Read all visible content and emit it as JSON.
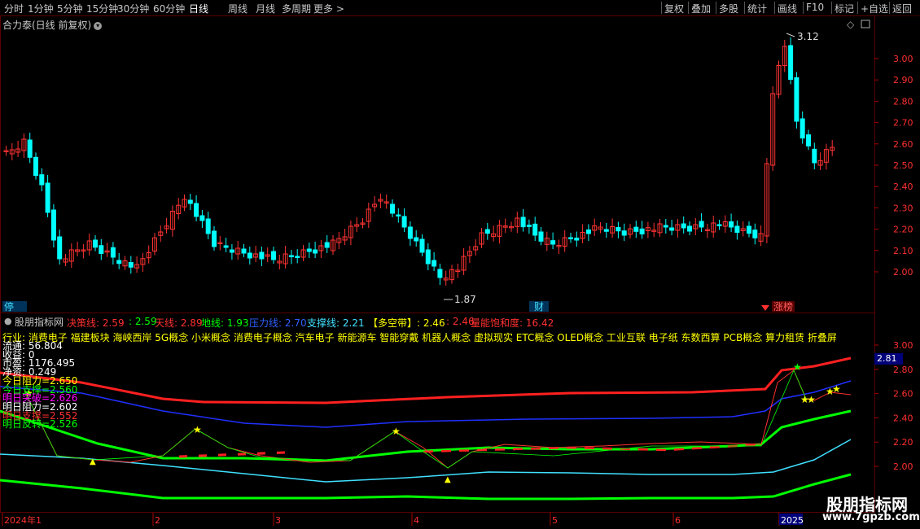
{
  "toolbar": {
    "left": [
      "分时",
      "1分钟",
      "5分钟",
      "15分钟",
      "30分钟",
      "60分钟",
      "日线",
      "周线",
      "月线",
      "多周期",
      "更多 >"
    ],
    "active_index": 6,
    "right": [
      "复权",
      "叠加",
      "多股",
      "统计",
      "画线",
      "F10",
      "标记",
      "+自选",
      "返回"
    ]
  },
  "stock_title": "合力泰(日线 前复权)",
  "price_labels": {
    "high": "3.12",
    "low": "1.87"
  },
  "markers": {
    "left": "停",
    "mid": "财",
    "right": "涨榜"
  },
  "panel": {
    "title": "股朋指标网",
    "items": [
      {
        "label": "决策线:",
        "value": "2.59",
        "color": "#ff3030"
      },
      {
        "label": "",
        "value": ": 2.59",
        "color": "#00ff00"
      },
      {
        "label": "天线:",
        "value": "2.89",
        "color": "#ff3030"
      },
      {
        "label": "地线:",
        "value": "1.93",
        "color": "#00ff00"
      },
      {
        "label": "压力线:",
        "value": "2.70",
        "color": "#3060ff"
      },
      {
        "label": "支撑线:",
        "value": "2.21",
        "color": "#40e0ff"
      },
      {
        "label": "【多空带】:",
        "value": "2.46",
        "color": "#ffff00"
      },
      {
        "label": "",
        "value": ": 2.46",
        "color": "#ff3030"
      },
      {
        "label": "量能饱和度:",
        "value": "16.42",
        "color": "#ff3030"
      }
    ],
    "industry": "行业: 消费电子  福建板块  海峡西岸 5G概念 小米概念 消费电子概念 汽车电子 新能源车 智能穿戴 机器人概念 虚拟现实 ETC概念 OLED概念 工业互联 电子纸 东数西算 PCB概念 算力租赁 折叠屏",
    "info": [
      {
        "text": "流通: 56.804",
        "color": "#ffffff"
      },
      {
        "text": "收益: 0",
        "color": "#ffffff"
      },
      {
        "text": "市盈: 1176.495",
        "color": "#ffffff"
      },
      {
        "text": "净资: 0.249",
        "color": "#ffffff"
      },
      {
        "text": "今日阻力=2.650",
        "color": "#ffff00"
      },
      {
        "text": "今日支撑=2.560",
        "color": "#00ff00"
      },
      {
        "text": "明日突破=2.626",
        "color": "#ff00ff"
      },
      {
        "text": "明日阻力=2.602",
        "color": "#ffffff"
      },
      {
        "text": "明日支撑=2.552",
        "color": "#ff3030"
      },
      {
        "text": "明日反转=2.526",
        "color": "#00ff00"
      }
    ],
    "price_tag": "2.81"
  },
  "axis": {
    "main_ticks": [
      "3.00",
      "2.90",
      "2.80",
      "2.70",
      "2.60",
      "2.50",
      "2.40",
      "2.30",
      "2.20",
      "2.10",
      "2.00"
    ],
    "sub_ticks": [
      "3.00",
      "2.80",
      "2.60",
      "2.40",
      "2.20",
      "2.00"
    ],
    "dates": [
      "2024年1",
      "2",
      "3",
      "4",
      "5",
      "6",
      "2025"
    ]
  },
  "watermark": {
    "name": "股朋指标网",
    "url": "www.7gpzb.com"
  },
  "colors": {
    "up": "#ff3333",
    "down": "#00ffff",
    "bg": "#000000",
    "grid": "#5a0000"
  }
}
